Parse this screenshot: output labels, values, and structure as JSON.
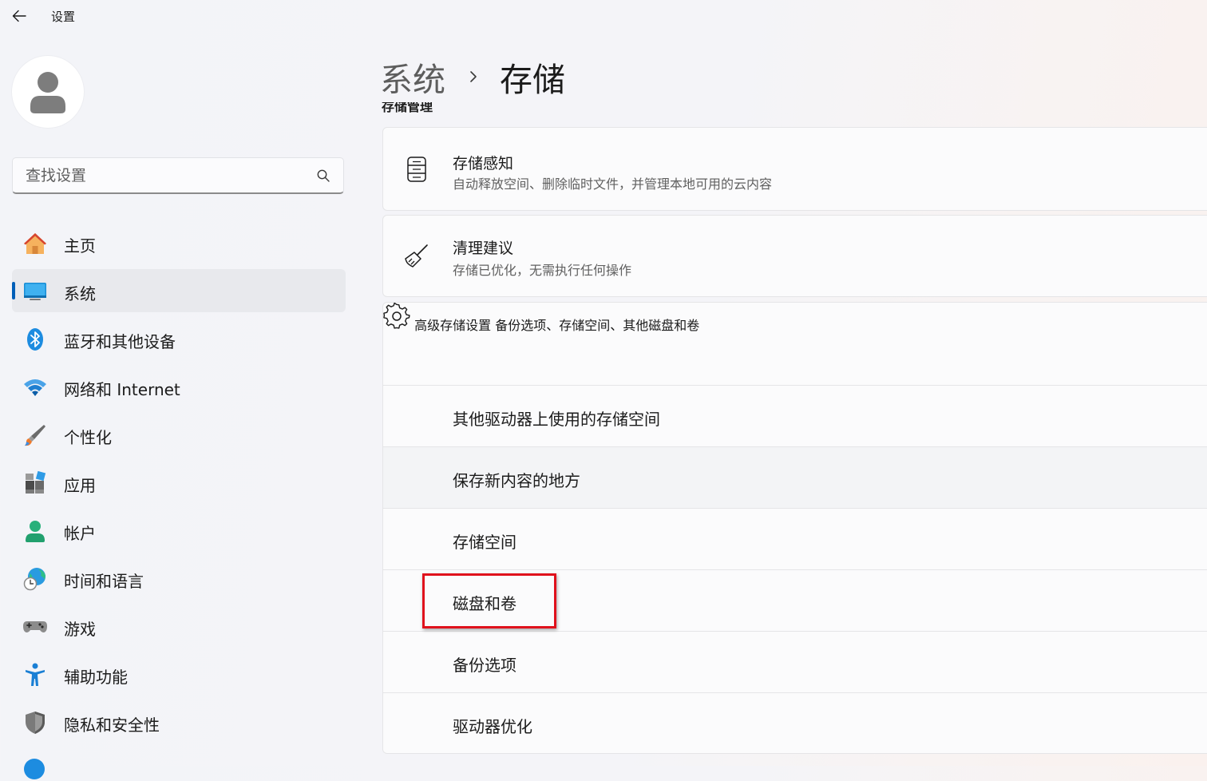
{
  "window": {
    "title": "设置"
  },
  "sidebar": {
    "search_placeholder": "查找设置",
    "items": [
      {
        "label": "主页",
        "icon": "home-icon",
        "active": false
      },
      {
        "label": "系统",
        "icon": "system-icon",
        "active": true
      },
      {
        "label": "蓝牙和其他设备",
        "icon": "bluetooth-icon",
        "active": false
      },
      {
        "label": "网络和 Internet",
        "icon": "wifi-icon",
        "active": false
      },
      {
        "label": "个性化",
        "icon": "brush-icon",
        "active": false
      },
      {
        "label": "应用",
        "icon": "apps-icon",
        "active": false
      },
      {
        "label": "帐户",
        "icon": "account-icon",
        "active": false
      },
      {
        "label": "时间和语言",
        "icon": "globe-clock-icon",
        "active": false
      },
      {
        "label": "游戏",
        "icon": "gamepad-icon",
        "active": false
      },
      {
        "label": "辅助功能",
        "icon": "accessibility-icon",
        "active": false
      },
      {
        "label": "隐私和安全性",
        "icon": "shield-icon",
        "active": false
      }
    ]
  },
  "main": {
    "breadcrumb": {
      "parent": "系统",
      "current": "存储"
    },
    "section_title": "存储管理",
    "cards": [
      {
        "title": "存储感知",
        "description": "自动释放空间、删除临时文件，并管理本地可用的云内容",
        "icon": "storage-drive-icon"
      },
      {
        "title": "清理建议",
        "description": "存储已优化，无需执行任何操作",
        "icon": "broom-icon"
      }
    ],
    "advanced": {
      "title": "高级存储设置",
      "description": "备份选项、存储空间、其他磁盘和卷",
      "icon": "gear-icon",
      "items": [
        {
          "label": "其他驱动器上使用的存储空间"
        },
        {
          "label": "保存新内容的地方"
        },
        {
          "label": "存储空间"
        },
        {
          "label": "磁盘和卷"
        },
        {
          "label": "备份选项"
        },
        {
          "label": "驱动器优化"
        }
      ]
    }
  },
  "annotation": {
    "highlight_color": "#e0111c",
    "highlighted_item": "磁盘和卷"
  },
  "colors": {
    "accent": "#005fb8"
  }
}
